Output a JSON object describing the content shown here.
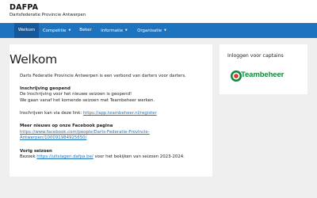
{
  "site": {
    "title": "DAFPA",
    "tagline": "Dartsfederatie Provincie Antwerpen"
  },
  "nav": {
    "items": [
      {
        "label": "Welkom",
        "active": true,
        "has_dropdown": false
      },
      {
        "label": "Competitie",
        "active": false,
        "has_dropdown": true
      },
      {
        "label": "Beker",
        "active": false,
        "has_dropdown": false
      },
      {
        "label": "Informatie",
        "active": false,
        "has_dropdown": true
      },
      {
        "label": "Organisatie",
        "active": false,
        "has_dropdown": true
      }
    ]
  },
  "main": {
    "title": "Welkom",
    "intro": "Darts Federatie Provincie Antwerpen is een verbond van darters voor darters.",
    "section1": {
      "heading": "Inschrijving geopend",
      "line1": "De Inschrijving voor het nieuwe seizoen is geopend!",
      "line2": "We gaan vanaf het komende seizoen met Teambeheer werken."
    },
    "register": {
      "prefix": "Inschrijven kan via deze link: ",
      "link": "https://app.teambeheer.nl/register"
    },
    "facebook": {
      "heading": "Meer nieuws op onze Facebook pagina",
      "link_line1": "https://www.facebook.com/people/Darts-Federatie-Provincie-",
      "link_line2": "Antwerpen/100091984925650/"
    },
    "previous": {
      "heading": "Vorig seizoen",
      "prefix": "Bezoek ",
      "link": "https://uitslagen.dafpa.be/",
      "suffix": " voor het bekijken van seizoen 2023-2024."
    }
  },
  "sidebar": {
    "title": "Inloggen voor captains",
    "logo_text": "Teambeheer"
  },
  "colors": {
    "nav_bg": "#1e73be",
    "nav_active": "#16589a",
    "link": "#1e73be",
    "logo_green": "#0e8a3a",
    "logo_red": "#e2322b"
  }
}
